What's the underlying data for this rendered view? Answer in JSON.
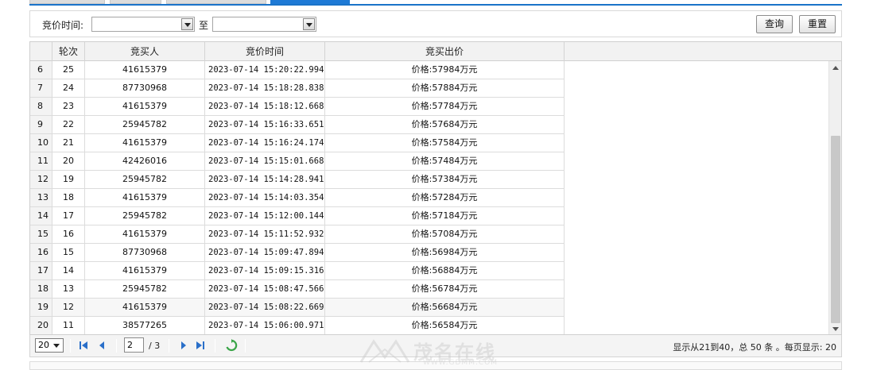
{
  "search": {
    "time_label": "竞价时间:",
    "to_label": "至",
    "start_value": "",
    "end_value": "",
    "query_label": "查询",
    "reset_label": "重置"
  },
  "grid": {
    "columns": [
      "",
      "轮次",
      "竞买人",
      "竞价时间",
      "竞买出价"
    ],
    "rows": [
      {
        "idx": "6",
        "round": "25",
        "bidder": "41615379",
        "time": "2023-07-14 15:20:22.994",
        "price": "价格:57984万元"
      },
      {
        "idx": "7",
        "round": "24",
        "bidder": "87730968",
        "time": "2023-07-14 15:18:28.838",
        "price": "价格:57884万元"
      },
      {
        "idx": "8",
        "round": "23",
        "bidder": "41615379",
        "time": "2023-07-14 15:18:12.668",
        "price": "价格:57784万元"
      },
      {
        "idx": "9",
        "round": "22",
        "bidder": "25945782",
        "time": "2023-07-14 15:16:33.651",
        "price": "价格:57684万元"
      },
      {
        "idx": "10",
        "round": "21",
        "bidder": "41615379",
        "time": "2023-07-14 15:16:24.174",
        "price": "价格:57584万元"
      },
      {
        "idx": "11",
        "round": "20",
        "bidder": "42426016",
        "time": "2023-07-14 15:15:01.668",
        "price": "价格:57484万元"
      },
      {
        "idx": "12",
        "round": "19",
        "bidder": "25945782",
        "time": "2023-07-14 15:14:28.941",
        "price": "价格:57384万元"
      },
      {
        "idx": "13",
        "round": "18",
        "bidder": "41615379",
        "time": "2023-07-14 15:14:03.354",
        "price": "价格:57284万元"
      },
      {
        "idx": "14",
        "round": "17",
        "bidder": "25945782",
        "time": "2023-07-14 15:12:00.144",
        "price": "价格:57184万元"
      },
      {
        "idx": "15",
        "round": "16",
        "bidder": "41615379",
        "time": "2023-07-14 15:11:52.932",
        "price": "价格:57084万元"
      },
      {
        "idx": "16",
        "round": "15",
        "bidder": "87730968",
        "time": "2023-07-14 15:09:47.894",
        "price": "价格:56984万元"
      },
      {
        "idx": "17",
        "round": "14",
        "bidder": "41615379",
        "time": "2023-07-14 15:09:15.316",
        "price": "价格:56884万元"
      },
      {
        "idx": "18",
        "round": "13",
        "bidder": "25945782",
        "time": "2023-07-14 15:08:47.566",
        "price": "价格:56784万元"
      },
      {
        "idx": "19",
        "round": "12",
        "bidder": "41615379",
        "time": "2023-07-14 15:08:22.669",
        "price": "价格:56684万元"
      },
      {
        "idx": "20",
        "round": "11",
        "bidder": "38577265",
        "time": "2023-07-14 15:06:00.971",
        "price": "价格:56584万元"
      }
    ]
  },
  "pager": {
    "page_size": "20",
    "current_page": "2",
    "total_pages": "/ 3",
    "summary": "显示从21到40，总 50 条 。每页显示: 20"
  },
  "watermark": {
    "brand": "茂名在线",
    "url": "WWW.GDMM.COM"
  },
  "colors": {
    "accent": "#1e7ad6",
    "refresh": "#3aa548",
    "nav": "#2a6fc9"
  }
}
